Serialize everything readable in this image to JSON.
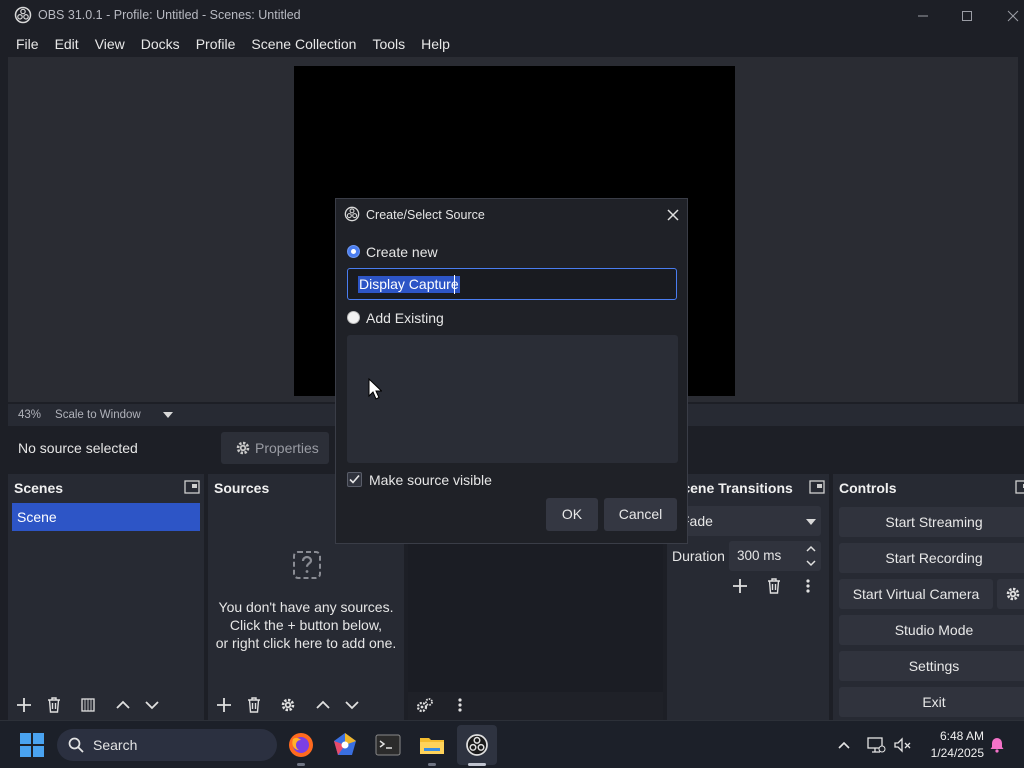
{
  "window": {
    "title": "OBS 31.0.1 - Profile: Untitled - Scenes: Untitled"
  },
  "menu": [
    "File",
    "Edit",
    "View",
    "Docks",
    "Profile",
    "Scene Collection",
    "Tools",
    "Help"
  ],
  "preview": {
    "zoom": "43%",
    "scale_mode": "Scale to Window"
  },
  "source_bar": {
    "status": "No source selected",
    "properties_label": "Properties"
  },
  "scenes": {
    "title": "Scenes",
    "items": [
      "Scene"
    ]
  },
  "sources": {
    "title": "Sources",
    "empty_lines": [
      "You don't have any sources.",
      "Click the + button below,",
      "or right click here to add one."
    ]
  },
  "transitions": {
    "title": "Scene Transitions",
    "selected": "Fade",
    "duration_label": "Duration",
    "duration_value": "300 ms"
  },
  "controls": {
    "title": "Controls",
    "buttons": [
      "Start Streaming",
      "Start Recording",
      "Start Virtual Camera",
      "Studio Mode",
      "Settings",
      "Exit"
    ]
  },
  "dialog": {
    "title": "Create/Select Source",
    "create_new_label": "Create new",
    "name_value": "Display Capture",
    "add_existing_label": "Add Existing",
    "make_visible_label": "Make source visible",
    "ok_label": "OK",
    "cancel_label": "Cancel"
  },
  "taskbar": {
    "search_placeholder": "Search",
    "time": "6:48 AM",
    "date": "1/24/2025"
  },
  "colors": {
    "accent": "#2d55c6",
    "background": "#1d1f26",
    "panel": "#272a33"
  }
}
